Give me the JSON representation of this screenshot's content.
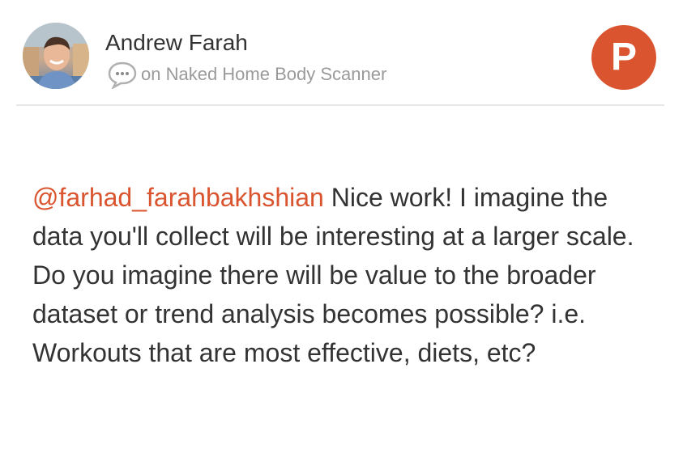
{
  "author": {
    "name": "Andrew Farah",
    "avatar_icon": "user-photo-avatar"
  },
  "meta": {
    "icon": "comment-bubble-icon",
    "context_text": "on Naked Home Body Scanner"
  },
  "brand": {
    "logo_letter": "P",
    "logo_icon": "product-hunt-logo-icon",
    "accent_color": "#da552f"
  },
  "comment": {
    "mention": "@farhad_farahbakhshian",
    "text": "Nice work! I imagine the data you'll collect will be interesting at a larger scale. Do you imagine there will be value to the broader dataset or trend analysis becomes possible? i.e. Workouts that are most effective, diets, etc?"
  },
  "colors": {
    "text": "#333333",
    "muted": "#9a9a9a",
    "divider": "#e6e6e6"
  }
}
